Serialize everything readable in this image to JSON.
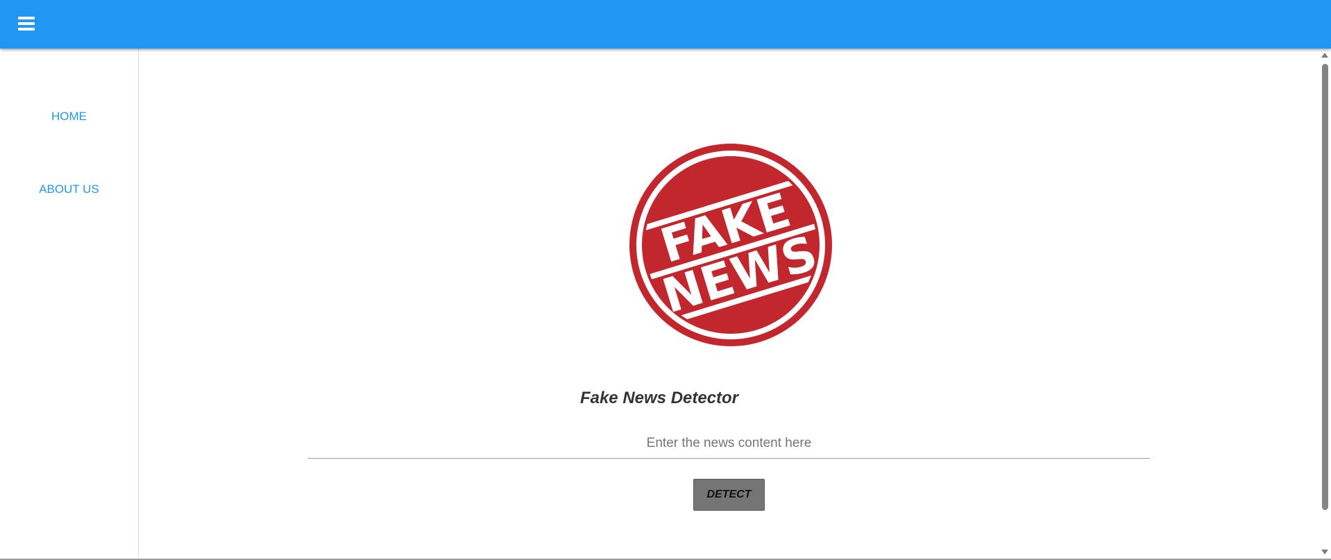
{
  "header": {
    "menu_icon": "hamburger-menu-icon",
    "color": "#2196f3"
  },
  "sidebar": {
    "items": [
      {
        "label": "HOME"
      },
      {
        "label": "ABOUT US"
      }
    ],
    "link_color": "#2196f3"
  },
  "main": {
    "logo": {
      "line1": "FAKE",
      "line2": "NEWS",
      "color": "#c1272d"
    },
    "title": "Fake News Detector",
    "input": {
      "placeholder": "Enter the news content here",
      "value": ""
    },
    "detect_button": "DETECT"
  }
}
